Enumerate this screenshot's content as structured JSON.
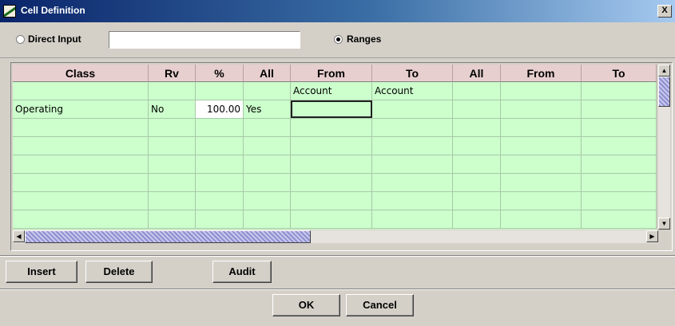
{
  "window": {
    "title": "Cell Definition",
    "close_label": "X"
  },
  "options": {
    "direct_input_label": "Direct Input",
    "direct_input_value": "",
    "ranges_label": "Ranges",
    "selected": "Ranges"
  },
  "table": {
    "columns": [
      "Class",
      "Rv",
      "%",
      "All",
      "From",
      "To",
      "All",
      "From",
      "To"
    ],
    "rows": [
      [
        "",
        "",
        "",
        "",
        "Account",
        "Account",
        "",
        "",
        ""
      ],
      [
        "Operating",
        "No",
        "100.00",
        "Yes",
        "",
        "",
        "",
        "",
        ""
      ],
      [
        "",
        "",
        "",
        "",
        "",
        "",
        "",
        "",
        ""
      ],
      [
        "",
        "",
        "",
        "",
        "",
        "",
        "",
        "",
        ""
      ],
      [
        "",
        "",
        "",
        "",
        "",
        "",
        "",
        "",
        ""
      ],
      [
        "",
        "",
        "",
        "",
        "",
        "",
        "",
        "",
        ""
      ],
      [
        "",
        "",
        "",
        "",
        "",
        "",
        "",
        "",
        ""
      ],
      [
        "",
        "",
        "",
        "",
        "",
        "",
        "",
        "",
        ""
      ]
    ]
  },
  "scrollbars": {
    "up": "▲",
    "down": "▼",
    "left": "◀",
    "right": "▶"
  },
  "action_buttons": {
    "insert": "Insert",
    "delete": "Delete",
    "audit": "Audit"
  },
  "dialog_buttons": {
    "ok": "OK",
    "cancel": "Cancel"
  },
  "colors": {
    "grid_bg": "#ccffcc",
    "header_bg": "#e8cfcf",
    "titlebar": "#0a246a"
  }
}
